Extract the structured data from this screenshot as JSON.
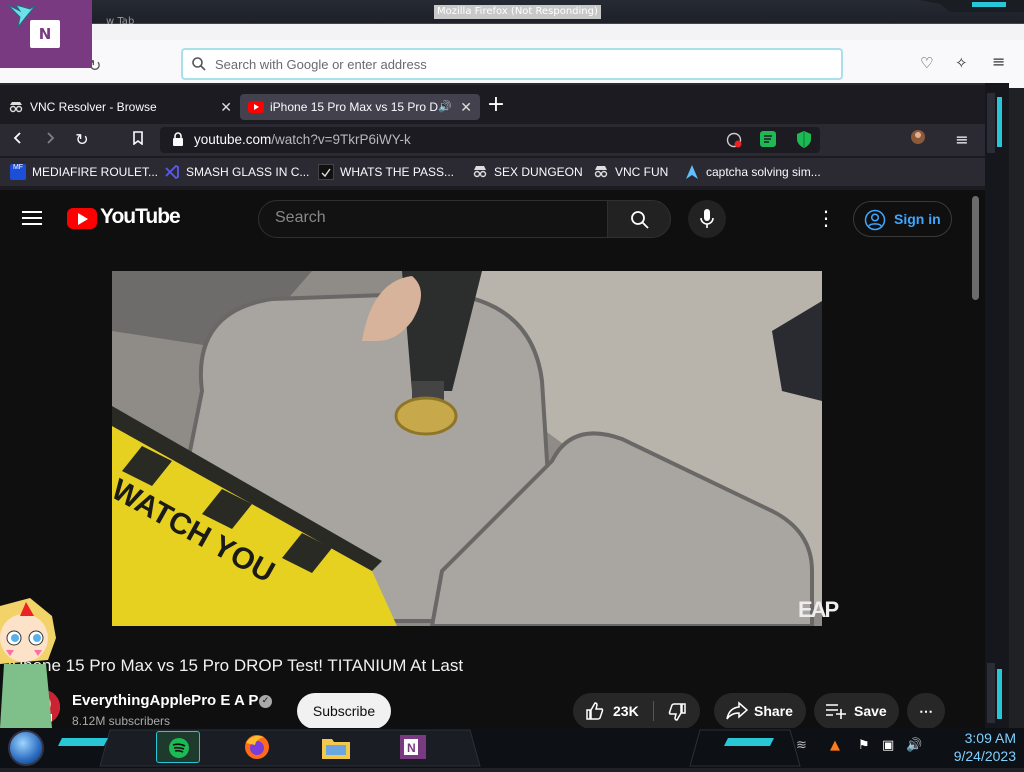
{
  "background_window": {
    "title": "Mozilla Firefox (Not Responding)",
    "tab_fragment": "w Tab",
    "search_placeholder": "Search with Google or enter address"
  },
  "browser": {
    "tabs": [
      {
        "label": "VNC Resolver - Browse",
        "active": false
      },
      {
        "label": "iPhone 15 Pro Max vs 15 Pro D",
        "active": true
      }
    ],
    "url_host": "youtube.com",
    "url_path": "/watch?v=9TkrP6iWY-k",
    "bookmarks": [
      {
        "label": "MEDIAFIRE ROULET...",
        "icon": "mediafire-icon",
        "color": "#1c4ed8"
      },
      {
        "label": "SMASH GLASS IN C...",
        "icon": "visual-studio-icon",
        "color": "#3a3ad0"
      },
      {
        "label": "WHATS THE PASS...",
        "icon": "terminal-icon",
        "color": "#222222"
      },
      {
        "label": "SEX DUNGEON",
        "icon": "spy-icon",
        "color": "#dddddd"
      },
      {
        "label": "VNC FUN",
        "icon": "spy-icon",
        "color": "#dddddd"
      },
      {
        "label": "captcha solving sim...",
        "icon": "arch-icon",
        "color": "#60c0ff"
      }
    ]
  },
  "youtube": {
    "logo_text": "YouTube",
    "search_placeholder": "Search",
    "signin_label": "Sign in",
    "video_title": "iPhone 15 Pro Max vs 15 Pro DROP Test! TITANIUM At Last",
    "watermark": "EAP",
    "channel_name": "EverythingApplePro E A P",
    "subscribers": "8.12M subscribers",
    "subscribe_label": "Subscribe",
    "likes": "23K",
    "share_label": "Share",
    "save_label": "Save",
    "caution_text": "WATCH YOU"
  },
  "taskbar": {
    "time": "3:09 AM",
    "date": "9/24/2023",
    "apps": [
      "spotify-icon",
      "firefox-icon",
      "file-explorer-icon",
      "onenote-icon"
    ]
  },
  "colors": {
    "yt_red": "#ff0000",
    "accent_cyan": "#29c6d8",
    "onenote_purple": "#7a3a82"
  }
}
